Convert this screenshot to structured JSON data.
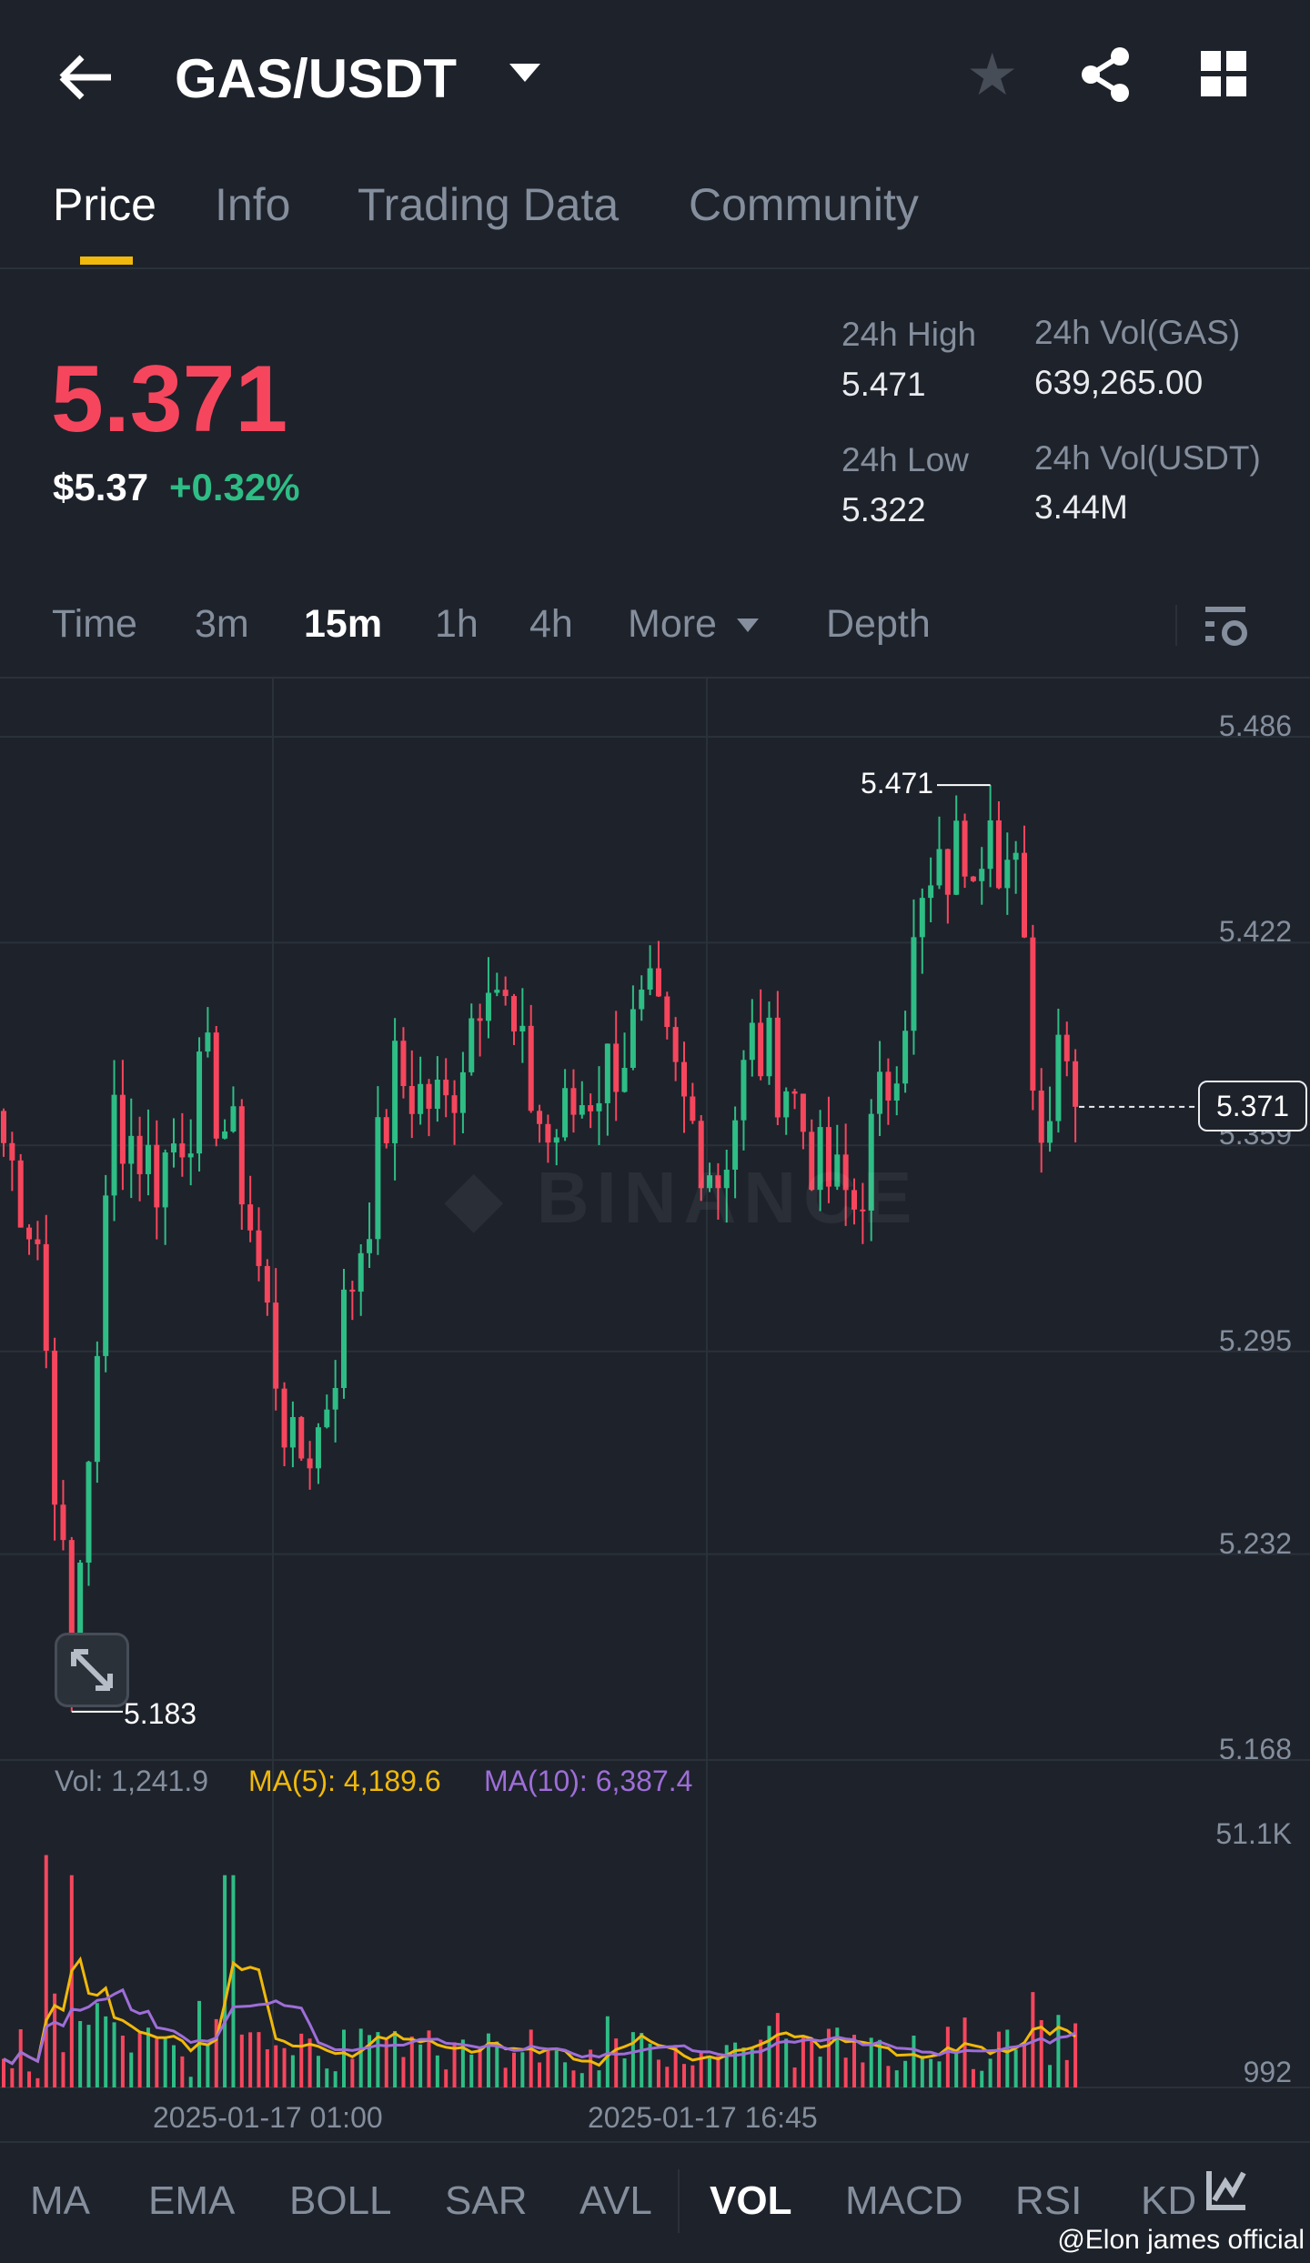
{
  "header": {
    "title": "GAS/USDT"
  },
  "tabs": [
    {
      "label": "Price"
    },
    {
      "label": "Info"
    },
    {
      "label": "Trading Data"
    },
    {
      "label": "Community"
    }
  ],
  "ticker": {
    "last_price": "5.371",
    "usd_price": "$5.37",
    "change": "+0.32%",
    "high_label": "24h High",
    "high": "5.471",
    "low_label": "24h Low",
    "low": "5.322",
    "vol_base_label": "24h Vol(GAS)",
    "vol_base": "639,265.00",
    "vol_quote_label": "24h Vol(USDT)",
    "vol_quote": "3.44M"
  },
  "intervals": {
    "time": "Time",
    "m3": "3m",
    "m15": "15m",
    "h1": "1h",
    "h4": "4h",
    "more": "More",
    "depth": "Depth"
  },
  "chart": {
    "price_ticks": [
      "5.486",
      "5.422",
      "5.359",
      "5.295",
      "5.232",
      "5.168"
    ],
    "high_marker": "5.471",
    "low_marker": "5.183",
    "current_price": "5.371",
    "watermark": "BINANCE",
    "vol_legend": {
      "vol": "Vol: 1,241.9",
      "ma5": "MA(5): 4,189.6",
      "ma10": "MA(10): 6,387.4"
    },
    "vol_ticks": [
      "51.1K",
      "992"
    ],
    "dates": [
      "2025-01-17 01:00",
      "2025-01-17 16:45"
    ],
    "colors": {
      "up": "#2ebd85",
      "down": "#f6465d",
      "ma5": "#f0b90b",
      "ma10": "#9e6ed8"
    },
    "price_path": [
      [
        0,
        5.36
      ],
      [
        4,
        5.33
      ],
      [
        8,
        5.19
      ],
      [
        11,
        5.3
      ],
      [
        13,
        5.37
      ],
      [
        18,
        5.35
      ],
      [
        24,
        5.38
      ],
      [
        28,
        5.35
      ],
      [
        34,
        5.26
      ],
      [
        37,
        5.27
      ],
      [
        42,
        5.33
      ],
      [
        46,
        5.38
      ],
      [
        52,
        5.37
      ],
      [
        57,
        5.42
      ],
      [
        60,
        5.39
      ],
      [
        64,
        5.36
      ],
      [
        70,
        5.38
      ],
      [
        76,
        5.4
      ],
      [
        80,
        5.37
      ],
      [
        84,
        5.35
      ],
      [
        88,
        5.39
      ],
      [
        92,
        5.38
      ],
      [
        96,
        5.35
      ],
      [
        100,
        5.34
      ],
      [
        104,
        5.38
      ],
      [
        108,
        5.43
      ],
      [
        112,
        5.45
      ],
      [
        116,
        5.46
      ],
      [
        119,
        5.44
      ],
      [
        122,
        5.36
      ],
      [
        124,
        5.4
      ],
      [
        126,
        5.371
      ]
    ]
  },
  "indicators": [
    {
      "label": "MA"
    },
    {
      "label": "EMA"
    },
    {
      "label": "BOLL"
    },
    {
      "label": "SAR"
    },
    {
      "label": "AVL"
    },
    {
      "label": "VOL"
    },
    {
      "label": "MACD"
    },
    {
      "label": "RSI"
    },
    {
      "label": "KD"
    }
  ],
  "watermark_credit": "@Elon james official"
}
